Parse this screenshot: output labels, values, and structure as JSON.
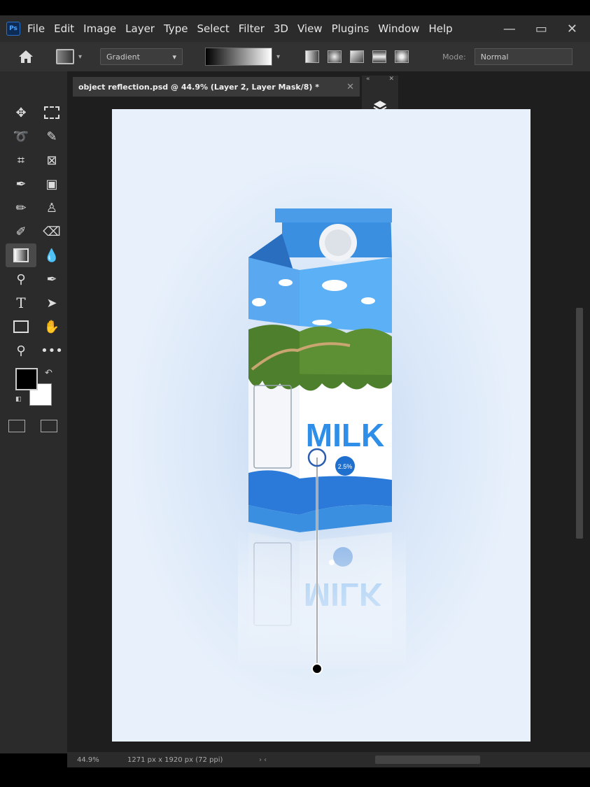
{
  "app": {
    "logo_text": "Ps"
  },
  "menu": {
    "items": [
      "File",
      "Edit",
      "Image",
      "Layer",
      "Type",
      "Select",
      "Filter",
      "3D",
      "View",
      "Plugins",
      "Window",
      "Help"
    ]
  },
  "window_controls": {
    "minimize": "—",
    "restore": "▭",
    "close": "✕"
  },
  "options": {
    "home_icon": "home-icon",
    "preset_label": "Gradient",
    "mode_label": "Mode:",
    "mode_value": "Normal"
  },
  "document": {
    "tab_title": "object reflection.psd @ 44.9% (Layer 2, Layer Mask/8) *",
    "tab_close": "✕"
  },
  "panel": {
    "collapse": "«",
    "close": "✕"
  },
  "carton": {
    "brand": "MILK",
    "fat_badge": "2.5%"
  },
  "status": {
    "zoom": "44.9%",
    "doc_size": "1271 px x 1920 px (72 ppi)",
    "arrows": "›  ‹"
  },
  "colors": {
    "foreground": "#000000",
    "background": "#ffffff",
    "carton_blue": "#3b8fe0"
  }
}
